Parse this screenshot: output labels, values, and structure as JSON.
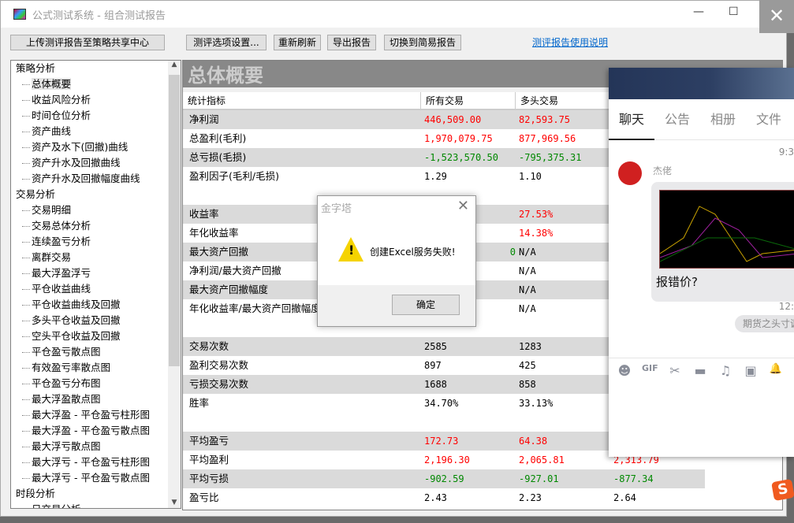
{
  "window": {
    "title": "公式测试系统 - 组合测试报告",
    "minimize": "—",
    "maximize": "☐",
    "close": "✕"
  },
  "overlay_close": "✕",
  "toolbar": {
    "upload": "上传测评报告至策略共享中心",
    "settings": "测评选项设置...",
    "refresh": "重新刷新",
    "export": "导出报告",
    "switch": "切换到简易报告",
    "help_link": "测评报告使用说明"
  },
  "tree": [
    {
      "t": "策略分析",
      "g": true
    },
    {
      "t": "总体概要",
      "sel": true
    },
    {
      "t": "收益风险分析"
    },
    {
      "t": "时间仓位分析"
    },
    {
      "t": "资产曲线"
    },
    {
      "t": "资产及水下(回撤)曲线"
    },
    {
      "t": "资产升水及回撤曲线"
    },
    {
      "t": "资产升水及回撤幅度曲线"
    },
    {
      "t": "交易分析",
      "g": true
    },
    {
      "t": "交易明细"
    },
    {
      "t": "交易总体分析"
    },
    {
      "t": "连续盈亏分析"
    },
    {
      "t": "离群交易"
    },
    {
      "t": "最大浮盈浮亏"
    },
    {
      "t": "平仓收益曲线"
    },
    {
      "t": "平仓收益曲线及回撤"
    },
    {
      "t": "多头平仓收益及回撤"
    },
    {
      "t": "空头平仓收益及回撤"
    },
    {
      "t": "平仓盈亏散点图"
    },
    {
      "t": "有效盈亏率散点图"
    },
    {
      "t": "平仓盈亏分布图"
    },
    {
      "t": "最大浮盈散点图"
    },
    {
      "t": "最大浮盈 - 平仓盈亏柱形图"
    },
    {
      "t": "最大浮盈 - 平仓盈亏散点图"
    },
    {
      "t": "最大浮亏散点图"
    },
    {
      "t": "最大浮亏 - 平仓盈亏柱形图"
    },
    {
      "t": "最大浮亏 - 平仓盈亏散点图"
    },
    {
      "t": "时段分析",
      "g": true
    },
    {
      "t": "日交易分析"
    }
  ],
  "report": {
    "title": "总体概要",
    "headers": [
      "统计指标",
      "所有交易",
      "多头交易"
    ],
    "rows": [
      {
        "label": "净利润",
        "gray": true,
        "values": [
          [
            "446,509.00",
            "red"
          ],
          [
            "82,593.75",
            "red"
          ],
          [
            "",
            ""
          ]
        ]
      },
      {
        "label": "总盈利(毛利)",
        "values": [
          [
            "1,970,079.75",
            "red"
          ],
          [
            "877,969.56",
            "red"
          ],
          [
            "",
            ""
          ]
        ]
      },
      {
        "label": "总亏损(毛损)",
        "gray": true,
        "values": [
          [
            "-1,523,570.50",
            "green"
          ],
          [
            "-795,375.31",
            "green"
          ],
          [
            "",
            ""
          ]
        ]
      },
      {
        "label": "盈利因子(毛利/毛损)",
        "values": [
          [
            "1.29",
            "black"
          ],
          [
            "1.10",
            "black"
          ],
          [
            "",
            ""
          ]
        ]
      },
      {
        "spacer": true
      },
      {
        "label": "收益率",
        "gray": true,
        "values": [
          [
            "",
            ""
          ],
          [
            "27.53%",
            "red"
          ],
          [
            "",
            ""
          ]
        ]
      },
      {
        "label": "年化收益率",
        "values": [
          [
            "",
            ""
          ],
          [
            "14.38%",
            "red"
          ],
          [
            "",
            ""
          ]
        ]
      },
      {
        "label": "最大资产回撤",
        "gray": true,
        "values": [
          [
            "0",
            "green"
          ],
          [
            "N/A",
            "black"
          ],
          [
            "",
            ""
          ]
        ]
      },
      {
        "label": "净利润/最大资产回撤",
        "values": [
          [
            "",
            ""
          ],
          [
            "N/A",
            "black"
          ],
          [
            "",
            ""
          ]
        ]
      },
      {
        "label": "最大资产回撤幅度",
        "gray": true,
        "values": [
          [
            "",
            ""
          ],
          [
            "N/A",
            "black"
          ],
          [
            "",
            ""
          ]
        ]
      },
      {
        "label": "年化收益率/最大资产回撤幅度",
        "values": [
          [
            "",
            ""
          ],
          [
            "N/A",
            "black"
          ],
          [
            "",
            ""
          ]
        ]
      },
      {
        "spacer": true
      },
      {
        "label": "交易次数",
        "gray": true,
        "values": [
          [
            "2585",
            "black"
          ],
          [
            "1283",
            "black"
          ],
          [
            "",
            ""
          ]
        ]
      },
      {
        "label": "盈利交易次数",
        "values": [
          [
            "897",
            "black"
          ],
          [
            "425",
            "black"
          ],
          [
            "",
            ""
          ]
        ]
      },
      {
        "label": "亏损交易次数",
        "gray": true,
        "values": [
          [
            "1688",
            "black"
          ],
          [
            "858",
            "black"
          ],
          [
            "",
            ""
          ]
        ]
      },
      {
        "label": "胜率",
        "values": [
          [
            "34.70%",
            "black"
          ],
          [
            "33.13%",
            "black"
          ],
          [
            "",
            ""
          ]
        ]
      },
      {
        "spacer": true
      },
      {
        "label": "平均盈亏",
        "gray": true,
        "values": [
          [
            "172.73",
            "red"
          ],
          [
            "64.38",
            "red"
          ],
          [
            "",
            ""
          ]
        ]
      },
      {
        "label": "平均盈利",
        "values": [
          [
            "2,196.30",
            "red"
          ],
          [
            "2,065.81",
            "red"
          ],
          [
            "2,313.79",
            "red"
          ]
        ]
      },
      {
        "label": "平均亏损",
        "gray": true,
        "values": [
          [
            "-902.59",
            "green"
          ],
          [
            "-927.01",
            "green"
          ],
          [
            "-877.34",
            "green"
          ]
        ]
      },
      {
        "label": "盈亏比",
        "values": [
          [
            "2.43",
            "black"
          ],
          [
            "2.23",
            "black"
          ],
          [
            "2.64",
            "black"
          ]
        ]
      }
    ]
  },
  "dialog": {
    "title": "金字塔",
    "message": "创建Excel服务失败!",
    "ok": "确定",
    "close": "✕",
    "warn": "!"
  },
  "chat": {
    "tabs": [
      "聊天",
      "公告",
      "相册",
      "文件"
    ],
    "time1": "9:3",
    "sender": "杰佬",
    "message": "报错价?",
    "time2": "12:",
    "pill": "期货之头寸调",
    "tools": [
      "☻",
      "GIF",
      "✂",
      "▬",
      "♫",
      "▣",
      "🔔"
    ]
  },
  "ime_logo": "S"
}
